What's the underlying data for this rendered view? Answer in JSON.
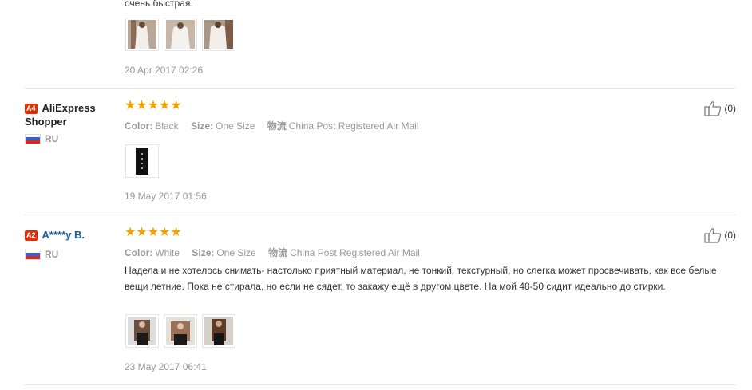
{
  "top_review": {
    "text_fragment": "очень быстрая.",
    "date": "20 Apr 2017 02:26",
    "photos": [
      "photo-1",
      "photo-2",
      "photo-3"
    ]
  },
  "reviews": [
    {
      "badge": "A4",
      "name": "AliExpress Shopper",
      "country": "RU",
      "stars": "★★★★★",
      "color_label": "Color:",
      "color_value": "Black",
      "size_label": "Size:",
      "size_value": "One Size",
      "shipping_label": "物流",
      "shipping_value": "China Post Registered Air Mail",
      "text": "",
      "date": "19 May 2017 01:56",
      "helpful": "(0)"
    },
    {
      "badge": "A2",
      "name": "A****y B.",
      "country": "RU",
      "stars": "★★★★★",
      "color_label": "Color:",
      "color_value": "White",
      "size_label": "Size:",
      "size_value": "One Size",
      "shipping_label": "物流",
      "shipping_value": "China Post Registered Air Mail",
      "text": "Надела и не хотелось снимать- настолько приятный материал, не тонкий, текстурный, но слегка может просвечивать, как все белые вещи летние. Пока не стирала, но если не сядет, то закажу ещё в другом цвете. На мой 48-50 сидит идеально до стирки.",
      "date": "23 May 2017 06:41",
      "helpful": "(0)"
    }
  ],
  "colors": {
    "star": "#f5a000",
    "badge": "#e62e04",
    "name_link": "#1b5e9e",
    "muted": "#999999"
  }
}
